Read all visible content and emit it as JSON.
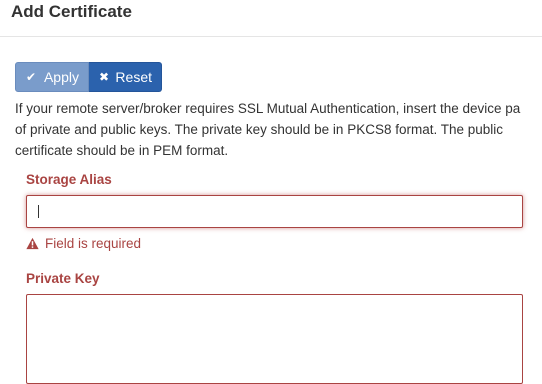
{
  "dialog": {
    "title": "Add Certificate"
  },
  "toolbar": {
    "apply_label": "Apply",
    "apply_icon": "check-icon",
    "reset_label": "Reset",
    "reset_icon": "close-icon"
  },
  "description": "If your remote server/broker requires SSL Mutual Authentication, insert the device pa\nof private and public keys. The private key should be in PKCS8 format. The public\ncertificate should be in PEM format.",
  "form": {
    "storage_alias": {
      "label": "Storage Alias",
      "value": "",
      "error": "Field is required"
    },
    "private_key": {
      "label": "Private Key",
      "value": ""
    }
  },
  "colors": {
    "error": "#a94442",
    "apply_button": "#7a9ccb",
    "reset_button": "#2b62ad"
  }
}
